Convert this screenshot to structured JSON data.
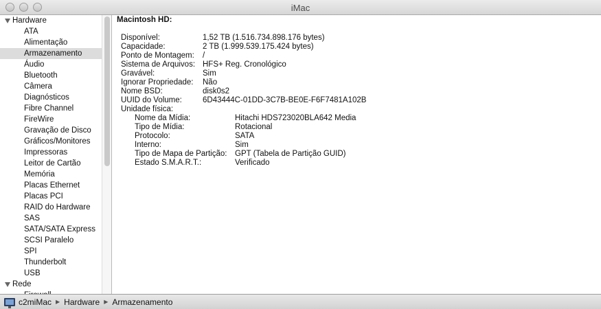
{
  "window": {
    "title": "iMac"
  },
  "sidebar": {
    "groups": [
      {
        "label": "Hardware",
        "items": [
          "ATA",
          "Alimentação",
          "Armazenamento",
          "Áudio",
          "Bluetooth",
          "Câmera",
          "Diagnósticos",
          "Fibre Channel",
          "FireWire",
          "Gravação de Disco",
          "Gráficos/Monitores",
          "Impressoras",
          "Leitor de Cartão",
          "Memória",
          "Placas Ethernet",
          "Placas PCI",
          "RAID do Hardware",
          "SAS",
          "SATA/SATA Express",
          "SCSI Paralelo",
          "SPI",
          "Thunderbolt",
          "USB"
        ]
      },
      {
        "label": "Rede",
        "items": [
          "Firewall"
        ]
      }
    ],
    "selected": "Armazenamento"
  },
  "detail": {
    "heading": "Macintosh HD:",
    "properties": [
      {
        "label": "Disponível:",
        "value": "1,52 TB (1.516.734.898.176 bytes)"
      },
      {
        "label": "Capacidade:",
        "value": "2 TB (1.999.539.175.424 bytes)"
      },
      {
        "label": "Ponto de Montagem:",
        "value": "/"
      },
      {
        "label": "Sistema de Arquivos:",
        "value": "HFS+ Reg. Cronológico"
      },
      {
        "label": "Gravável:",
        "value": "Sim"
      },
      {
        "label": "Ignorar Propriedade:",
        "value": "Não"
      },
      {
        "label": "Nome BSD:",
        "value": "disk0s2"
      },
      {
        "label": "UUID do Volume:",
        "value": "6D43444C-01DD-3C7B-BE0E-F6F7481A102B"
      },
      {
        "label": "Unidade física:",
        "value": ""
      }
    ],
    "physical_drive": [
      {
        "label": "Nome da Mídia:",
        "value": "Hitachi HDS723020BLA642 Media"
      },
      {
        "label": "Tipo de Mídia:",
        "value": "Rotacional"
      },
      {
        "label": "Protocolo:",
        "value": "SATA"
      },
      {
        "label": "Interno:",
        "value": "Sim"
      },
      {
        "label": "Tipo de Mapa de Partição:",
        "value": "GPT (Tabela de Partição GUID)"
      },
      {
        "label": "Estado S.M.A.R.T.:",
        "value": "Verificado"
      }
    ]
  },
  "breadcrumb": [
    "c2miMac",
    "Hardware",
    "Armazenamento"
  ]
}
